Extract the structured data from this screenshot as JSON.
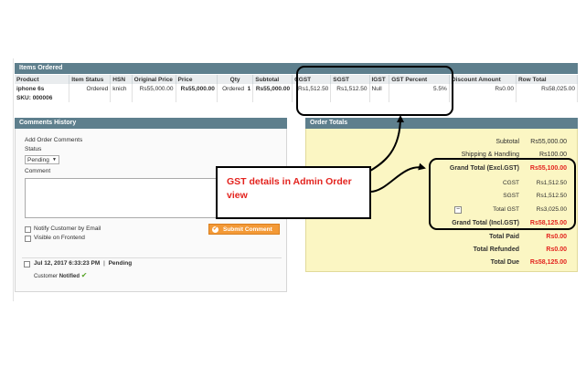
{
  "items": {
    "section_title": "Items Ordered",
    "headers": [
      "Product",
      "Item Status",
      "HSN",
      "Original Price",
      "Price",
      "Qty",
      "Subtotal",
      "CGST",
      "SGST",
      "IGST",
      "GST Percent",
      "Discount Amount",
      "Row Total"
    ],
    "row": {
      "product": "iphone 6s",
      "sku": "SKU: 000006",
      "item_status": "Ordered",
      "hsn": "knich",
      "original_price": "Rs55,000.00",
      "price": "Rs55,000.00",
      "qty_label": "Ordered",
      "qty_value": "1",
      "subtotal": "Rs55,000.00",
      "cgst": "Rs1,512.50",
      "sgst": "Rs1,512.50",
      "igst": "Null",
      "gst_percent": "5.5%",
      "discount": "Rs0.00",
      "row_total": "Rs58,025.00"
    }
  },
  "comments": {
    "section_title": "Comments History",
    "add_label": "Add Order Comments",
    "status_label": "Status",
    "status_value": "Pending",
    "comment_label": "Comment",
    "notify_label": "Notify Customer by Email",
    "visible_label": "Visible on Frontend",
    "submit_label": "Submit Comment",
    "history": {
      "date": "Jul 12, 2017 6:33:23 PM",
      "separator": "|",
      "status": "Pending",
      "customer_label": "Customer",
      "notified": "Notified"
    }
  },
  "totals": {
    "section_title": "Order Totals",
    "rows": [
      {
        "label": "Subtotal",
        "value": "Rs55,000.00"
      },
      {
        "label": "Shipping & Handling",
        "value": "Rs100.00"
      },
      {
        "label": "Grand Total (Excl.GST)",
        "value": "Rs55,100.00"
      },
      {
        "label": "CGST",
        "value": "Rs1,512.50"
      },
      {
        "label": "SGST",
        "value": "Rs1,512.50"
      },
      {
        "label": "Total GST",
        "value": "Rs3,025.00"
      },
      {
        "label": "Grand Total (Incl.GST)",
        "value": "Rs58,125.00"
      },
      {
        "label": "Total Paid",
        "value": "Rs0.00"
      },
      {
        "label": "Total Refunded",
        "value": "Rs0.00"
      },
      {
        "label": "Total Due",
        "value": "Rs58,125.00"
      }
    ]
  },
  "annotation": {
    "text": "GST details in Admin Order view"
  },
  "colors": {
    "header_bar": "#5e7f8d",
    "totals_bg": "#fbf6c3",
    "accent_red": "#e3231e",
    "button_orange": "#f39936",
    "check_green": "#5aa52a"
  }
}
